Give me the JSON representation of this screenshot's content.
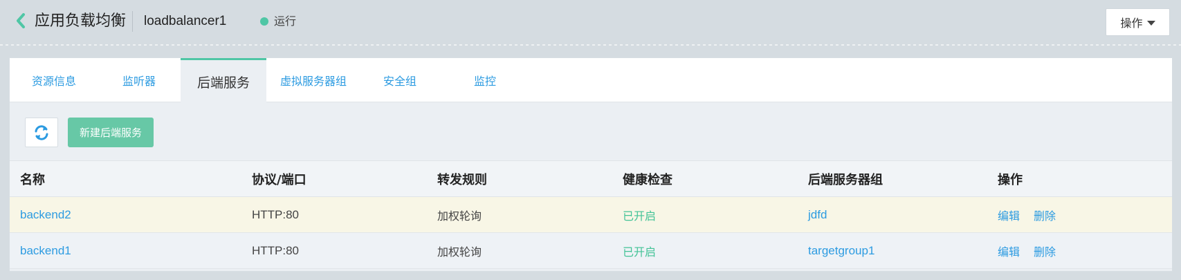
{
  "header": {
    "title": "应用负载均衡",
    "lb_name": "loadbalancer1",
    "status": "运行",
    "ops_label": "操作",
    "status_color": "#4fc6a5"
  },
  "tabs": [
    "资源信息",
    "监听器",
    "后端服务",
    "虚拟服务器组",
    "安全组",
    "监控"
  ],
  "active_tab": "后端服务",
  "toolbar": {
    "refresh_icon": "refresh-icon",
    "create_label": "新建后端服务"
  },
  "table": {
    "columns": [
      "名称",
      "协议/端口",
      "转发规则",
      "健康检查",
      "后端服务器组",
      "操作"
    ],
    "rows": [
      {
        "name": "backend2",
        "protocol": "HTTP:80",
        "rule": "加权轮询",
        "health": "已开启",
        "group": "jdfd",
        "edit": "编辑",
        "delete": "删除"
      },
      {
        "name": "backend1",
        "protocol": "HTTP:80",
        "rule": "加权轮询",
        "health": "已开启",
        "group": "targetgroup1",
        "edit": "编辑",
        "delete": "删除"
      }
    ]
  },
  "colors": {
    "accent": "#2c9be1",
    "primary_button": "#67c8a6",
    "health_on": "#43c397"
  }
}
